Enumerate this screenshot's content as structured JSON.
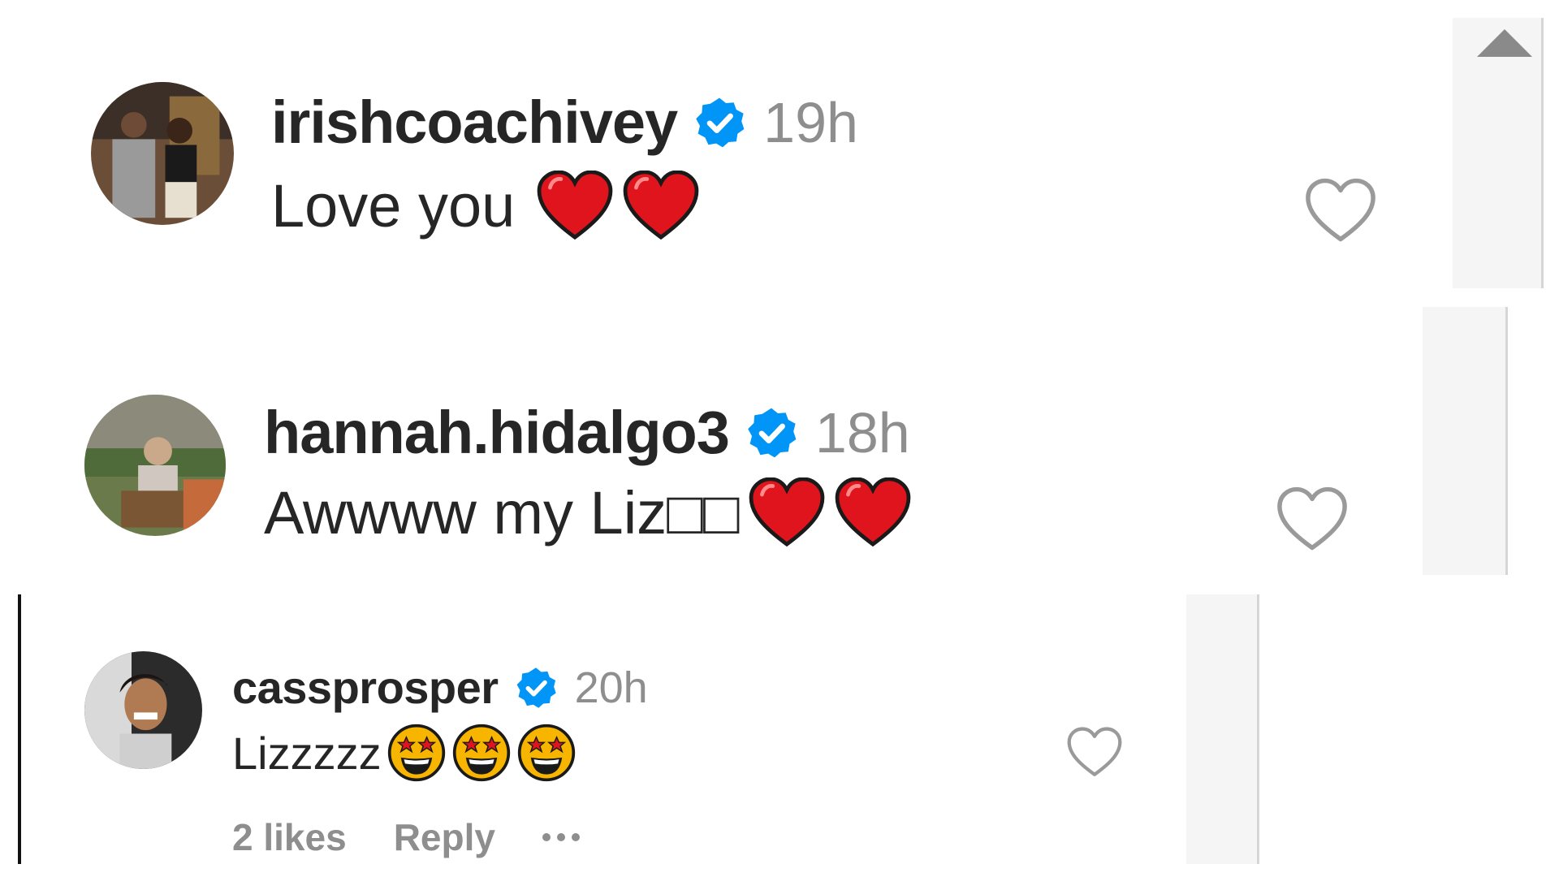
{
  "comments": [
    {
      "username": "irishcoachivey",
      "verified": true,
      "time": "19h",
      "text": "Love you",
      "emojis": [
        "red-heart-emoji",
        "red-heart-emoji"
      ]
    },
    {
      "username": "hannah.hidalgo3",
      "verified": true,
      "time": "18h",
      "text": "Awwww my Liz□□",
      "emojis": [
        "red-heart-emoji",
        "red-heart-emoji"
      ]
    },
    {
      "username": "cassprosper",
      "verified": true,
      "time": "20h",
      "text": "Lizzzzz",
      "emojis": [
        "star-struck-emoji",
        "star-struck-emoji",
        "star-struck-emoji"
      ],
      "likes": "2 likes",
      "reply_label": "Reply"
    }
  ],
  "icons": {
    "like": "heart-outline-icon",
    "verified": "verified-badge-icon",
    "more": "more-horizontal-icon",
    "scroll": "scroll-up-arrow-icon"
  },
  "colors": {
    "text": "#262626",
    "muted": "#8e8e8e",
    "verified": "#0095f6",
    "heart": "#e0141c",
    "scrollbar": "#f5f5f5"
  }
}
